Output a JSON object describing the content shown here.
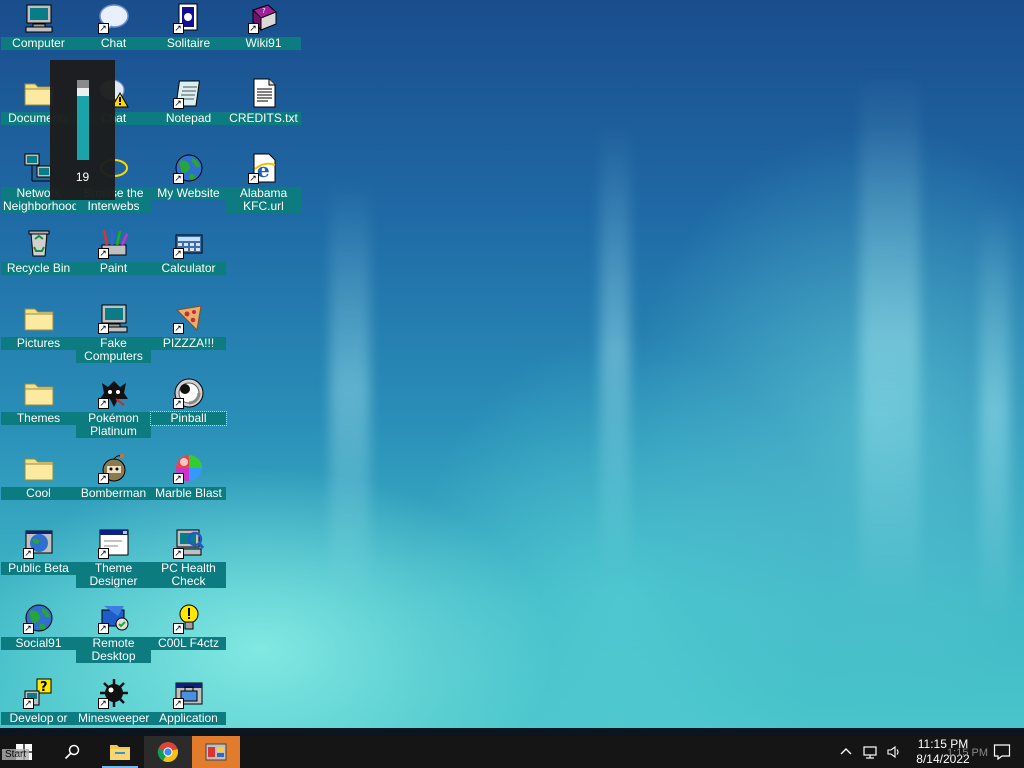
{
  "desktop_icons": [
    {
      "label": "Computer",
      "icon": "computer-icon",
      "shortcut": false
    },
    {
      "label": "Chat",
      "icon": "chat-bubble-icon",
      "shortcut": true
    },
    {
      "label": "Solitaire",
      "icon": "solitaire-icon",
      "shortcut": true
    },
    {
      "label": "Wiki91",
      "icon": "book-icon",
      "shortcut": true
    },
    {
      "label": "Documents",
      "icon": "folder-icon",
      "shortcut": false
    },
    {
      "label": "Chat",
      "icon": "chat-warning-icon",
      "shortcut": false
    },
    {
      "label": "Notepad",
      "icon": "notepad-icon",
      "shortcut": true
    },
    {
      "label": "CREDITS.txt",
      "icon": "text-file-icon",
      "shortcut": false
    },
    {
      "label": "Network Neighborhood",
      "icon": "network-icon",
      "shortcut": false
    },
    {
      "label": "Browse the Interwebs",
      "icon": "browser-icon",
      "shortcut": false
    },
    {
      "label": "My Website",
      "icon": "globe-icon",
      "shortcut": true
    },
    {
      "label": "Alabama KFC.url",
      "icon": "ie-url-icon",
      "shortcut": true
    },
    {
      "label": "Recycle Bin",
      "icon": "recycle-bin-icon",
      "shortcut": false
    },
    {
      "label": "Paint",
      "icon": "paint-icon",
      "shortcut": true
    },
    {
      "label": "Calculator",
      "icon": "calculator-icon",
      "shortcut": true
    },
    {
      "label": "Pictures",
      "icon": "folder-icon",
      "shortcut": false
    },
    {
      "label": "Fake Computers",
      "icon": "computer-icon",
      "shortcut": true
    },
    {
      "label": "PIZZZA!!!",
      "icon": "pizza-icon",
      "shortcut": true
    },
    {
      "label": "Themes",
      "icon": "folder-icon",
      "shortcut": false
    },
    {
      "label": "Pokémon Platinum",
      "icon": "pokemon-icon",
      "shortcut": true
    },
    {
      "label": "Pinball",
      "icon": "pinball-icon",
      "shortcut": true
    },
    {
      "label": "Cool",
      "icon": "folder-icon",
      "shortcut": false
    },
    {
      "label": "Bomberman",
      "icon": "bomberman-icon",
      "shortcut": true
    },
    {
      "label": "Marble Blast",
      "icon": "marble-icon",
      "shortcut": true
    },
    {
      "label": "Public Beta",
      "icon": "globe-window-icon",
      "shortcut": true
    },
    {
      "label": "Theme Designer",
      "icon": "window-icon",
      "shortcut": true
    },
    {
      "label": "PC Health Check",
      "icon": "health-check-icon",
      "shortcut": true
    },
    {
      "label": "Social91",
      "icon": "globe-icon",
      "shortcut": true
    },
    {
      "label": "Remote Desktop",
      "icon": "remote-desktop-icon",
      "shortcut": true
    },
    {
      "label": "C00L F4ctz",
      "icon": "lightbulb-icon",
      "shortcut": true
    },
    {
      "label": "Develop or",
      "icon": "help-icon",
      "shortcut": true
    },
    {
      "label": "Minesweeper",
      "icon": "mine-icon",
      "shortcut": true
    },
    {
      "label": "Application",
      "icon": "application-icon",
      "shortcut": true
    }
  ],
  "volume": {
    "value": "19",
    "level": 0.19
  },
  "taskbar": {
    "start_ghost": "Start",
    "apps": [
      {
        "name": "file-explorer",
        "icon": "folder-taskbar-icon"
      },
      {
        "name": "chrome",
        "icon": "chrome-icon"
      },
      {
        "name": "app-orange",
        "icon": "paint-taskbar-icon"
      }
    ],
    "time": "11:15 PM",
    "date": "8/14/2022",
    "clock_ghost": "1:15 PM"
  },
  "colors": {
    "label_bg": "#0d7c80",
    "volume_fill": "#1aa3a8",
    "taskbar_bg": "#151515",
    "orange_app": "#e27b2b"
  }
}
